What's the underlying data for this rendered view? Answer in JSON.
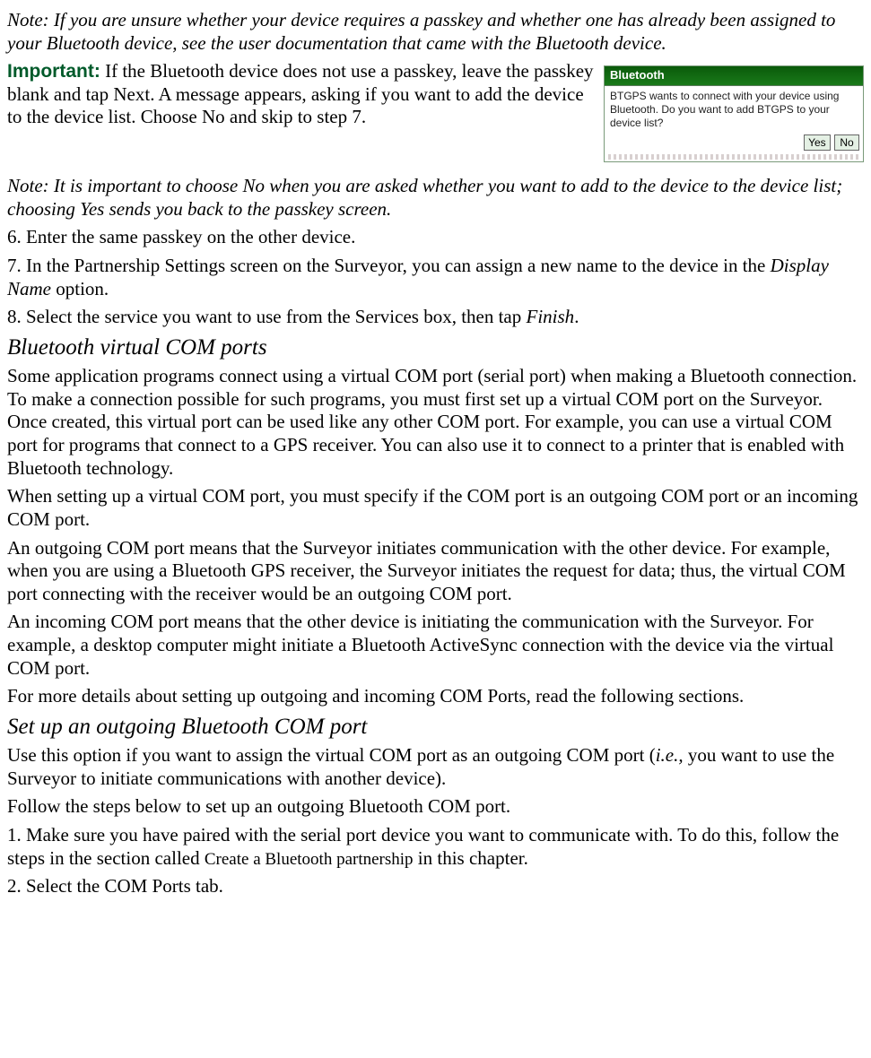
{
  "note1": "Note: If you are unsure whether your device requires a passkey and whether one has already been assigned to your Bluetooth device, see the user documentation that came with the Bluetooth device.",
  "important_label": "Important:",
  "important_text": " If the Bluetooth device does not use a passkey, leave the passkey blank and tap Next. A message appears, asking if you want to add the device to the device list. Choose No and skip to step 7.",
  "dialog": {
    "title": "Bluetooth",
    "body": "BTGPS wants to connect with your device using Bluetooth. Do you want to add BTGPS to your device list?",
    "yes": "Yes",
    "no": "No"
  },
  "note2": "Note: It is important to choose No when you are asked whether you want to add to the device to the device list; choosing Yes sends you back to the passkey screen.",
  "step6": "6.   Enter the same passkey on the other device.",
  "step7_a": "7.   In the Partnership Settings screen on the Surveyor, you can assign a new name to the device in the ",
  "step7_b": "Display Name",
  "step7_c": " option.",
  "step8_a": "8.   Select the service you want to use from the Services box, then tap ",
  "step8_b": "Finish",
  "step8_c": ".",
  "heading1": "Bluetooth virtual COM ports",
  "para1": "Some application programs connect using a virtual COM port (serial port) when making a Bluetooth connection. To make a connection possible for such programs, you must first set up a virtual COM port on the Surveyor. Once created, this virtual port can be used like any other COM port. For example, you can use a virtual COM port for programs that connect to a GPS receiver. You can also use it to connect to a printer that is enabled with Bluetooth technology.",
  "para2": "When setting up a virtual COM port, you must specify if the COM port is an outgoing COM port or an incoming COM port.",
  "para3": "An outgoing COM port means that the Surveyor initiates communication with the other device. For example, when you are using a Bluetooth GPS receiver, the Surveyor initiates the request for data; thus, the virtual COM port connecting with the receiver would be an outgoing COM port.",
  "para4": "An incoming COM port means that the other device is initiating the communication with the Surveyor. For example, a desktop computer might initiate a Bluetooth ActiveSync connection with the device via the virtual COM port.",
  "para5": "For more details about setting up outgoing and incoming COM Ports, read the following sections.",
  "heading2": "Set up an outgoing Bluetooth COM port",
  "out1_a": "Use this option if you want to assign the virtual COM port as an outgoing COM port (",
  "out1_b": "i.e.,",
  "out1_c": " you want to use the Surveyor to initiate communications with another device).",
  "out2": "Follow the steps below to set up an outgoing Bluetooth COM port.",
  "ostep1_a": "1.   Make sure you have paired with the serial port device you want to communicate with. To do this, follow the steps in the section called ",
  "ostep1_b": "Create a Bluetooth partnership",
  "ostep1_c": " in this chapter.",
  "ostep2": "2.   Select the COM Ports tab."
}
